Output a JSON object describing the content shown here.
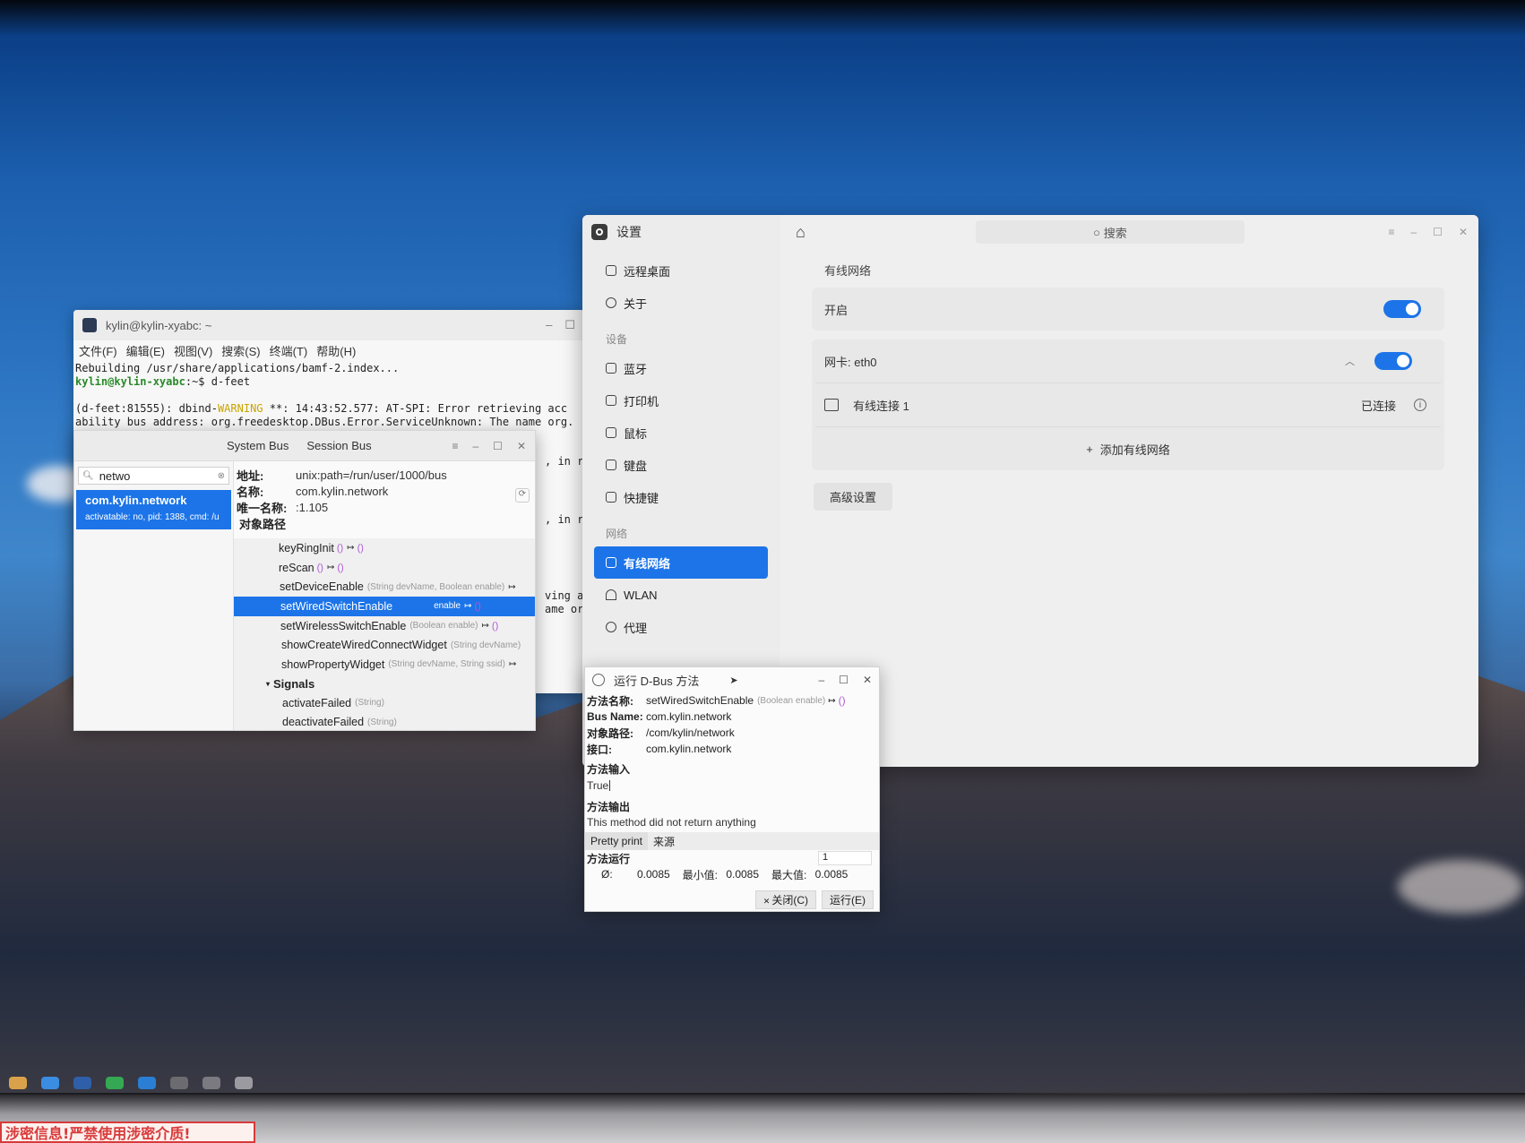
{
  "terminal": {
    "title": "kylin@kylin-xyabc: ~",
    "menu": [
      "文件(F)",
      "编辑(E)",
      "视图(V)",
      "搜索(S)",
      "终端(T)",
      "帮助(H)"
    ],
    "line1": "Rebuilding /usr/share/applications/bamf-2.index...",
    "prompt": "kylin@kylin-xyabc",
    "prompt_rest": ":~$ d-feet",
    "line3a": "(d-feet:81555): dbind-",
    "line3_warn": "WARNING",
    "line3b": " **: 14:43:52.577: AT-SPI: Error retrieving acc",
    "line4": "ability bus address: org.freedesktop.DBus.Error.ServiceUnknown: The name org.",
    "frag1": ", in run",
    "frag2": ", in reg",
    "frag3": "ving acc",
    "frag4": "ame org."
  },
  "dfeet": {
    "tabs": [
      "System Bus",
      "Session Bus"
    ],
    "search_value": "netwo",
    "service_name": "com.kylin.network",
    "service_detail": "activatable: no, pid: 1388, cmd: /u",
    "address_label": "地址:",
    "address": "unix:path=/run/user/1000/bus",
    "name_label": "名称:",
    "name": "com.kylin.network",
    "unique_label": "唯一名称:",
    "unique": ":1.105",
    "objpath_label": "对象路径",
    "methods": [
      {
        "name": "keyRingInit",
        "sig": "",
        "ret": "()"
      },
      {
        "name": "reScan",
        "sig": "",
        "ret": "()"
      },
      {
        "name": "setDeviceEnable",
        "sig": "(String devName, Boolean enable)",
        "ret": ""
      },
      {
        "name": "setWiredSwitchEnable",
        "sig": "enable",
        "ret": "()"
      },
      {
        "name": "setWirelessSwitchEnable",
        "sig": "(Boolean enable)",
        "ret": "()"
      },
      {
        "name": "showCreateWiredConnectWidget",
        "sig": "(String devName)",
        "ret": ""
      },
      {
        "name": "showPropertyWidget",
        "sig": "(String devName, String ssid)",
        "ret": ""
      }
    ],
    "signals_label": "Signals",
    "signals": [
      {
        "name": "activateFailed",
        "sig": "(String)"
      },
      {
        "name": "deactivateFailed",
        "sig": "(String)"
      }
    ]
  },
  "settings": {
    "app_title": "设置",
    "search_placeholder": "搜索",
    "nav_top": [
      "远程桌面",
      "关于"
    ],
    "group_device": "设备",
    "nav_device": [
      "蓝牙",
      "打印机",
      "鼠标",
      "键盘",
      "快捷键"
    ],
    "group_network": "网络",
    "nav_network": [
      "有线网络",
      "WLAN",
      "代理"
    ],
    "section_title": "有线网络",
    "enable_label": "开启",
    "nic_label": "网卡: eth0",
    "connection_name": "有线连接 1",
    "connection_status": "已连接",
    "add_wired": "添加有线网络",
    "advanced": "高级设置"
  },
  "dialog": {
    "title": "运行 D-Bus 方法",
    "method_label": "方法名称:",
    "method_name": "setWiredSwitchEnable",
    "method_sig": "(Boolean enable)",
    "method_ret": "()",
    "bus_label": "Bus Name:",
    "bus_name": "com.kylin.network",
    "path_label": "对象路径:",
    "path": "/com/kylin/network",
    "iface_label": "接口:",
    "iface": "com.kylin.network",
    "input_label": "方法输入",
    "input_value": "True",
    "output_label": "方法输出",
    "output_text": "This method did not return anything",
    "tabs": [
      "Pretty print",
      "来源"
    ],
    "run_label": "方法运行",
    "run_count": "1",
    "avg_label": "Ø:",
    "avg": "0.0085",
    "min_label": "最小值:",
    "min": "0.0085",
    "max_label": "最大值:",
    "max": "0.0085",
    "close_btn": "关闭(C)",
    "run_btn": "运行(E)"
  },
  "sticker_text": "涉密信息!严禁使用涉密介质!",
  "colors": {
    "accent": "#1c74e8",
    "signature": "#999999",
    "return": "#b05ad8"
  }
}
